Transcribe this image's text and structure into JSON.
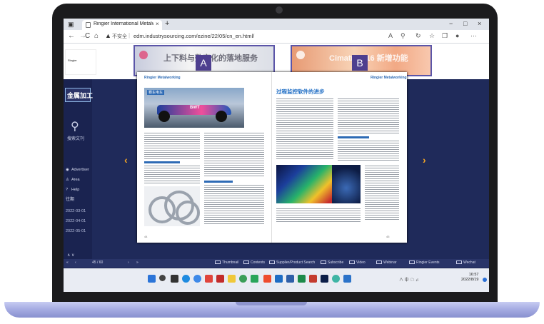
{
  "browser": {
    "tab_title": "Ringier International Metalworki",
    "tab_close": "×",
    "new_tab": "+",
    "window_controls": [
      "−",
      "□",
      "×"
    ],
    "nav": {
      "back": "←",
      "forward": "→",
      "refresh": "C",
      "home": "⌂"
    },
    "insecure_label": "不安全",
    "url": "edm.industrysourcing.com/ezine/22/05/cn_en.html/",
    "toolbar_icons": [
      "read-aloud-icon",
      "extensions-icon",
      "sync-icon",
      "favorites-icon",
      "collections-icon",
      "profile-icon",
      "more-icon"
    ]
  },
  "banners": {
    "a": {
      "text": "上下料与数字化的落地服务",
      "badge": "A"
    },
    "b": {
      "text": "Cimatron 16 新增功能",
      "badge": "B"
    }
  },
  "sidebar": {
    "logo_text": "金属加工",
    "search_label": "搜索文刊",
    "items": [
      {
        "icon": "◉",
        "label": "Advertiser"
      },
      {
        "icon": "♙",
        "label": "Area"
      },
      {
        "icon": "?",
        "label": "Help"
      }
    ],
    "calendar_label": "往期",
    "dates": [
      "2022-03-01",
      "2022-04-01",
      "2022-05-01"
    ],
    "pager": "∧   ∨"
  },
  "magazine": {
    "left_logo": "Ringier Metalworking",
    "right_logo": "Ringier Metalworking",
    "car_tag": "赛车电车",
    "car_sponsor": "BWT",
    "right_title": "过程监控软件的进步"
  },
  "viewer_toolbar": {
    "page_indicator": "45 / 60",
    "items": [
      "Thumbnail",
      "Contents",
      "Supplier/Product Search",
      "Subscribe",
      "Video",
      "Webinar",
      "Ringier Events",
      "Wechat"
    ]
  },
  "taskbar": {
    "clock_time": "16:57",
    "clock_date": "2022/8/19",
    "systray": "∧ 中 ☁ ♫"
  },
  "colors": {
    "accent_orange": "#f5a623",
    "badge_purple": "#4e3f8f",
    "page_bg": "#1f2a5a",
    "title_blue": "#1d6cc4"
  }
}
